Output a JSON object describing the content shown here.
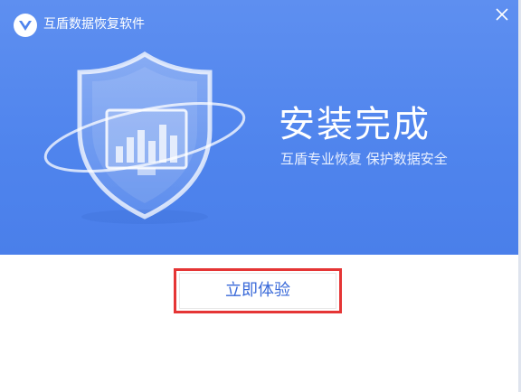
{
  "window": {
    "title": "互盾数据恢复软件",
    "logo_icon": "shield-v-logo-icon",
    "close_icon": "close-icon"
  },
  "banner": {
    "heading": "安装完成",
    "subheading": "互盾专业恢复 保护数据安全",
    "illustration_icon": "shield-monitor-chart-icon",
    "background_color": "#4f84ed"
  },
  "actions": {
    "start_label": "立即体验",
    "highlight_color": "#e53535"
  }
}
